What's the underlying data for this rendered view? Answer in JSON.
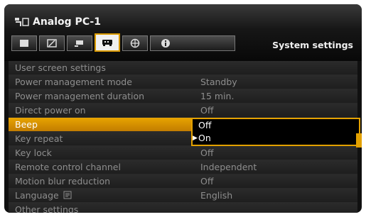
{
  "header": {
    "input_name": "Analog PC-1",
    "section_title": "System settings",
    "tabs": [
      {
        "icon": "image-adjust-icon"
      },
      {
        "icon": "image-quality-icon"
      },
      {
        "icon": "install-settings-icon"
      },
      {
        "icon": "system-settings-icon"
      },
      {
        "icon": "network-settings-icon"
      },
      {
        "icon": "information-icon"
      }
    ]
  },
  "menu": {
    "items": [
      {
        "label": "User screen settings",
        "value": ""
      },
      {
        "label": "Power management mode",
        "value": "Standby"
      },
      {
        "label": "Power management duration",
        "value": "15 min."
      },
      {
        "label": "Direct power on",
        "value": "Off"
      },
      {
        "label": "Beep",
        "value": ""
      },
      {
        "label": "Key repeat",
        "value": ""
      },
      {
        "label": "Key lock",
        "value": "Off"
      },
      {
        "label": "Remote control channel",
        "value": "Independent"
      },
      {
        "label": "Motion blur reduction",
        "value": "Off"
      },
      {
        "label": "Language",
        "value": "English"
      },
      {
        "label": "Other settings",
        "value": ""
      }
    ]
  },
  "dropdown": {
    "options": [
      "Off",
      "On"
    ],
    "selected": "On"
  },
  "colors": {
    "accent": "#e3a100",
    "dim_text": "#8e8e8e"
  }
}
